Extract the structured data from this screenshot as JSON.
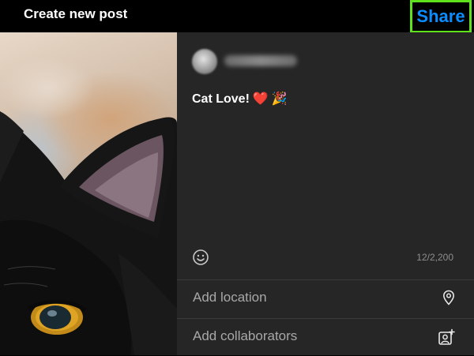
{
  "header": {
    "title": "Create new post",
    "share_label": "Share"
  },
  "post": {
    "caption_text": "Cat Love!",
    "caption_emoji_heart": "❤️",
    "caption_emoji_party": "🎉",
    "char_count": "12/2,200"
  },
  "options": {
    "add_location": "Add location",
    "add_collaborators": "Add collaborators"
  },
  "icons": [
    "smiley-icon",
    "location-pin-icon",
    "add-user-tag-icon"
  ],
  "colors": {
    "share_text": "#0a8dff",
    "share_highlight_border": "#5fe11b",
    "panel_bg": "#262626",
    "topbar_bg": "#000000",
    "muted_text": "#a8a8a8"
  }
}
